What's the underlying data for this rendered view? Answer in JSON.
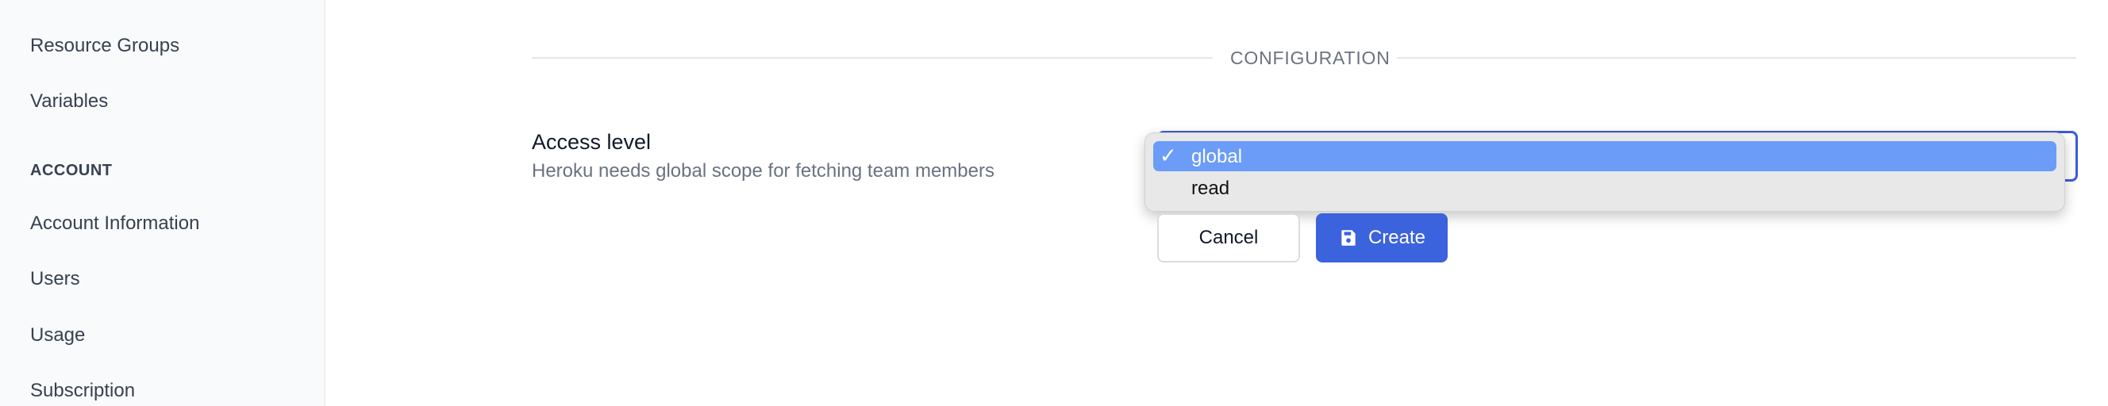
{
  "sidebar": {
    "items": [
      {
        "label": "Resource Groups"
      },
      {
        "label": "Variables"
      }
    ],
    "account_section": "ACCOUNT",
    "account_items": [
      {
        "label": "Account Information"
      },
      {
        "label": "Users"
      },
      {
        "label": "Usage"
      },
      {
        "label": "Subscription"
      }
    ]
  },
  "form": {
    "section_title": "CONFIGURATION",
    "access_level": {
      "label": "Access level",
      "help": "Heroku needs global scope for fetching team members",
      "selected": "global",
      "options": [
        {
          "label": "global",
          "selected": true,
          "check": "✓"
        },
        {
          "label": "read",
          "selected": false
        }
      ]
    },
    "cancel_label": "Cancel",
    "create_label": "Create"
  },
  "colors": {
    "primary": "#3b63dd",
    "selected_option": "#6b9cf7",
    "sidebar_bg": "#f9fafb"
  }
}
